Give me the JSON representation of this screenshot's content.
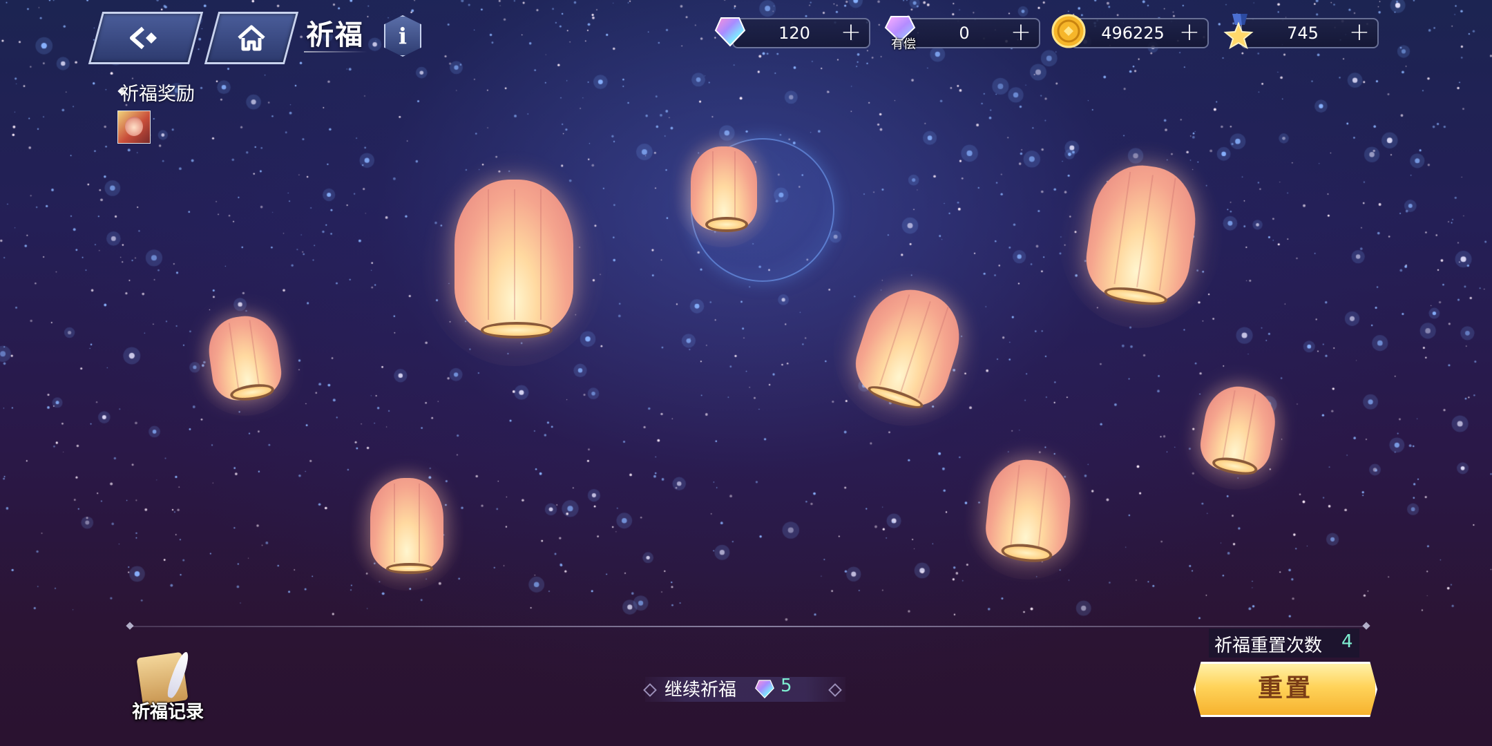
{
  "header": {
    "back_icon": "back-arrow-icon",
    "home_icon": "home-icon",
    "title": "祈福",
    "info_icon": "info-icon",
    "info_glyph": "i"
  },
  "currencies": [
    {
      "name": "free-gem",
      "icon": "rainbow-gem-icon",
      "value": "120",
      "plus": "+"
    },
    {
      "name": "paid-gem",
      "icon": "paid-gem-icon",
      "badge": "有偿",
      "value": "0",
      "plus": "+"
    },
    {
      "name": "gold",
      "icon": "gold-coin-icon",
      "value": "496225",
      "plus": "+"
    },
    {
      "name": "star-medal",
      "icon": "star-medal-icon",
      "value": "745",
      "plus": "+"
    }
  ],
  "reward": {
    "label": "祈福奖励",
    "item_icon": "character-portrait-icon"
  },
  "lanterns": [
    {
      "name": "lantern-1"
    },
    {
      "name": "lantern-2"
    },
    {
      "name": "lantern-3"
    },
    {
      "name": "lantern-4"
    },
    {
      "name": "lantern-5"
    },
    {
      "name": "lantern-6"
    },
    {
      "name": "lantern-7"
    },
    {
      "name": "lantern-8"
    },
    {
      "name": "lantern-9"
    }
  ],
  "bottom": {
    "record_label": "祈福记录",
    "continue_label": "继续祈福",
    "continue_cost": "5",
    "reset_count_label": "祈福重置次数",
    "reset_count_value": "4",
    "reset_label": "重置"
  },
  "colors": {
    "accent_teal": "#7ff0d2",
    "reset_button": "#ffd35a",
    "sky_top": "#1c2452",
    "sky_bottom": "#2a1230"
  }
}
